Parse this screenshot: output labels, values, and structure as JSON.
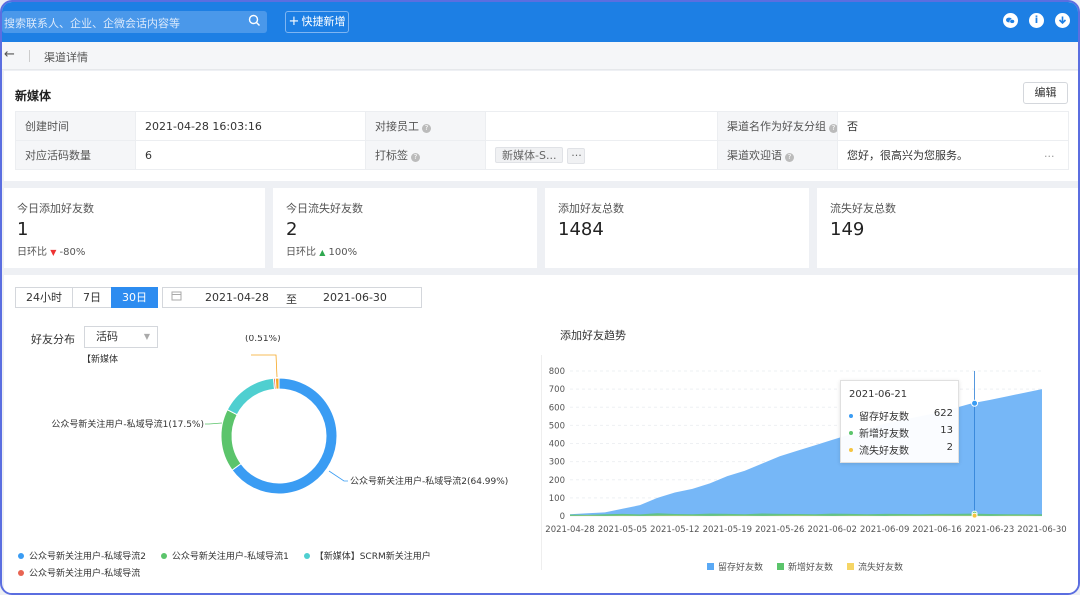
{
  "topbar": {
    "search_placeholder": "搜索联系人、企业、企微会话内容等",
    "quick_add": "快捷新增",
    "icons": [
      "wechat-icon",
      "info-icon",
      "download-icon"
    ]
  },
  "subbar": {
    "title": "渠道详情"
  },
  "info": {
    "title": "新媒体",
    "edit_label": "编辑",
    "rows": [
      {
        "k1": "创建时间",
        "v1": "2021-04-28 16:03:16",
        "k2": "对接员工",
        "v2": "",
        "k3": "渠道名作为好友分组",
        "v3": "否"
      },
      {
        "k1": "对应活码数量",
        "v1": "6",
        "k2": "打标签",
        "v2": "新媒体-S...",
        "v2_more": "···",
        "k3": "渠道欢迎语",
        "v3": "您好，很高兴为您服务。",
        "v3_more": "..."
      }
    ]
  },
  "stats": [
    {
      "label": "今日添加好友数",
      "value": "1",
      "compare_label": "日环比",
      "compare_value": "-80%"
    },
    {
      "label": "今日流失好友数",
      "value": "2",
      "compare_label": "日环比",
      "compare_value": "100%"
    },
    {
      "label": "添加好友总数",
      "value": "1484"
    },
    {
      "label": "流失好友总数",
      "value": "149"
    }
  ],
  "filters": {
    "ranges": [
      "24小时",
      "7日",
      "30日"
    ],
    "active_range": "30日",
    "start_date": "2021-04-28",
    "to_label": "至",
    "end_date": "2021-06-30"
  },
  "distribution": {
    "label": "好友分布",
    "select_value": "活码",
    "legend": [
      {
        "name": "公众号新关注用户-私域导流2",
        "color": "#3a9cf3"
      },
      {
        "name": "公众号新关注用户-私域导流1",
        "color": "#5bc46b"
      },
      {
        "name": "【新媒体】SCRM新关注用户",
        "color": "#4fcfd0"
      },
      {
        "name": "公众号新关注用户-私域导流",
        "color": "#e86452"
      }
    ]
  },
  "trend": {
    "title": "添加好友趋势",
    "tooltip": {
      "date": "2021-06-21",
      "rows": [
        {
          "name": "留存好友数",
          "value": "622",
          "color": "#3a9cf3"
        },
        {
          "name": "新增好友数",
          "value": "13",
          "color": "#5bc46b"
        },
        {
          "name": "流失好友数",
          "value": "2",
          "color": "#f5c542"
        }
      ]
    },
    "legend": [
      {
        "name": "留存好友数",
        "color": "#5aa9f5"
      },
      {
        "name": "新增好友数",
        "color": "#5bc46b"
      },
      {
        "name": "流失好友数",
        "color": "#f5d565"
      }
    ]
  },
  "chart_data": [
    {
      "type": "pie",
      "variant": "donut",
      "slices": [
        {
          "label": "公众号新关注用户-私域导流2(64.99%)",
          "value": 64.99,
          "color": "#3a9cf3"
        },
        {
          "label": "公众号新关注用户-私域导流1(17.5%)",
          "value": 17.5,
          "color": "#5bc46b"
        },
        {
          "label": "【新媒体】SCRM新关注用户",
          "value": 16.0,
          "color": "#4fcfd0"
        },
        {
          "label": "(0.51%)",
          "value": 0.51,
          "color": "#e86452"
        },
        {
          "label": "",
          "value": 1.0,
          "color": "#f5a623"
        }
      ],
      "truncated_labels": {
        "scrm": "【新媒体",
        "small": "(0.51%)"
      }
    },
    {
      "type": "area",
      "x_ticks": [
        "2021-04-28",
        "2021-05-05",
        "2021-05-12",
        "2021-05-19",
        "2021-05-26",
        "2021-06-02",
        "2021-06-09",
        "2021-06-16",
        "2021-06-23",
        "2021-06-30"
      ],
      "y_ticks": [
        0,
        100,
        200,
        300,
        400,
        500,
        600,
        700,
        800
      ],
      "ylim": [
        0,
        800
      ],
      "grid": true,
      "legend_position": "bottom",
      "series": [
        {
          "name": "留存好友数",
          "values": [
            10,
            15,
            20,
            40,
            60,
            100,
            130,
            150,
            180,
            220,
            250,
            290,
            330,
            360,
            390,
            420,
            450,
            480,
            510,
            530,
            550,
            570,
            595,
            622,
            640,
            660,
            680,
            700
          ]
        },
        {
          "name": "新增好友数",
          "values": [
            8,
            6,
            10,
            12,
            9,
            15,
            11,
            10,
            13,
            12,
            10,
            14,
            12,
            11,
            10,
            13,
            12,
            10,
            12,
            11,
            10,
            12,
            12,
            13,
            11,
            10,
            9,
            10
          ]
        },
        {
          "name": "流失好友数",
          "values": [
            1,
            2,
            1,
            2,
            1,
            2,
            3,
            2,
            1,
            2,
            2,
            1,
            2,
            3,
            2,
            1,
            2,
            2,
            1,
            2,
            2,
            3,
            2,
            2,
            1,
            2,
            2,
            1
          ]
        }
      ],
      "highlight": {
        "x": "2021-06-21",
        "series_values": [
          622,
          13,
          2
        ]
      }
    }
  ]
}
